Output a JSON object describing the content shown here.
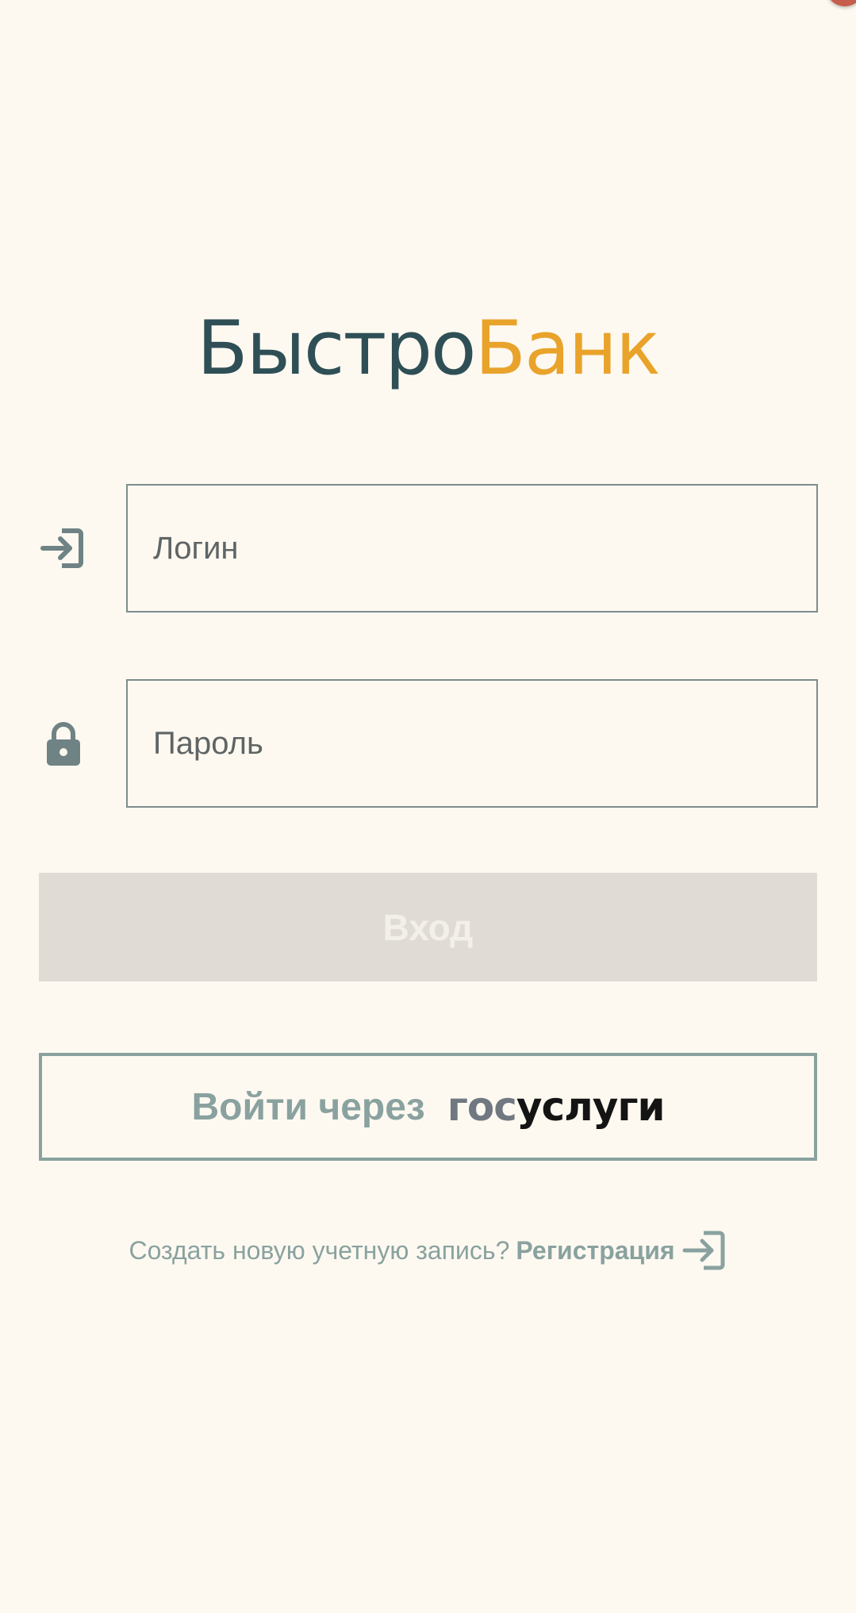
{
  "brand": {
    "part1": "Быстро",
    "part2": "Банк",
    "color_part1": "#2f4f56",
    "color_part2": "#e9a32a"
  },
  "login_field": {
    "placeholder": "Логин",
    "value": "",
    "icon": "login-arrow-icon"
  },
  "password_field": {
    "placeholder": "Пароль",
    "value": "",
    "icon": "lock-icon"
  },
  "login_button": {
    "label": "Вход",
    "enabled": false
  },
  "gosuslugi_button": {
    "label": "Войти через",
    "logo_part1": "гос",
    "logo_part2": "услуги"
  },
  "register": {
    "question": "Создать новую учетную запись?",
    "link_label": "Регистрация",
    "icon": "login-arrow-icon"
  },
  "colors": {
    "background": "#fdf9f1",
    "accent": "#8aa29f",
    "icon": "#6f8385",
    "disabled_button": "#e0dcd5"
  }
}
